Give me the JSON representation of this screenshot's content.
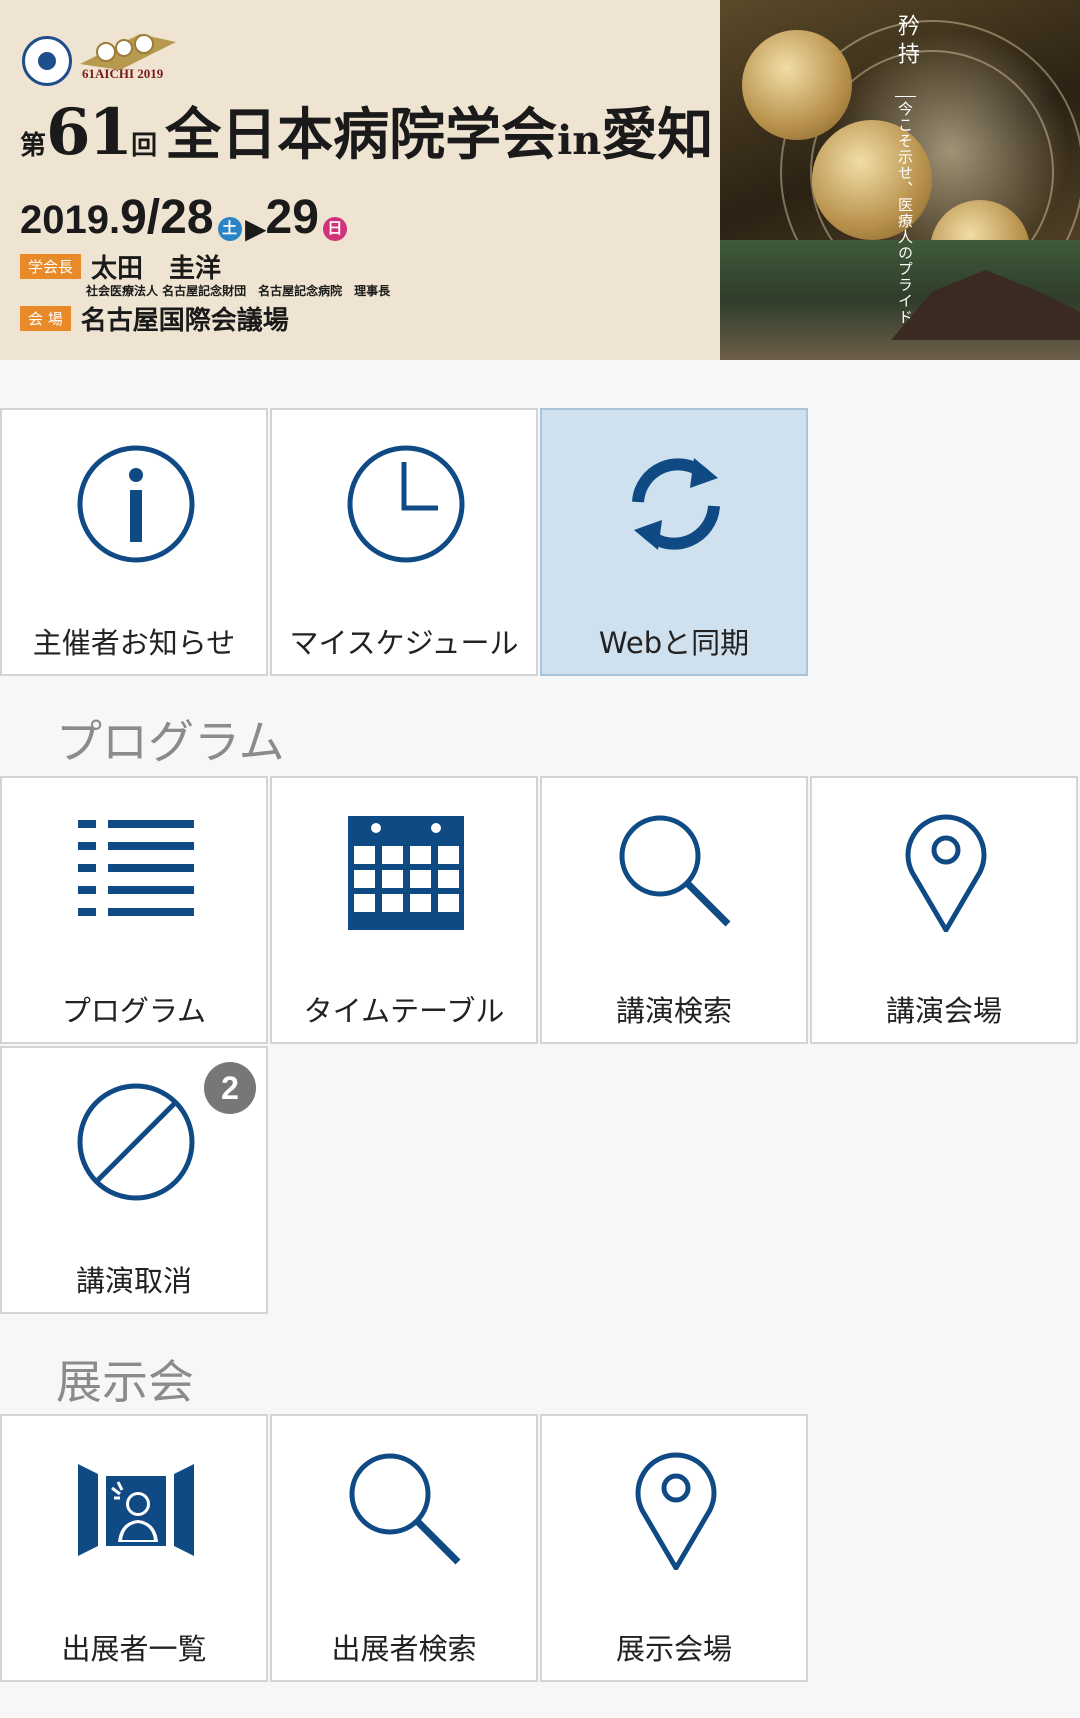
{
  "banner": {
    "logo_text": "61AICHI 2019",
    "title_ordinal": "第",
    "title_number": "61",
    "title_counter": "回",
    "title_main": "全日本病院学会",
    "title_in": "in",
    "title_place": "愛知",
    "date_year": "2019.",
    "date_month_day": "9/28",
    "date_start_dow": "土",
    "date_arrow": "▶",
    "date_end_day": "29",
    "date_end_dow": "日",
    "president_tag": "学会長",
    "president_name": "太田　圭洋",
    "president_affiliation": "社会医療法人 名古屋記念財団　名古屋記念病院　理事長",
    "venue_tag": "会 場",
    "venue_name": "名古屋国際会議場",
    "slogan": "矜持",
    "slogan_sub": "今こそ示せ、医療人のプライド"
  },
  "top_menu": [
    {
      "label": "主催者お知らせ",
      "icon": "info-icon"
    },
    {
      "label": "マイスケジュール",
      "icon": "clock-icon"
    },
    {
      "label": "Webと同期",
      "icon": "sync-icon",
      "active": true
    }
  ],
  "program_section": {
    "title": "プログラム",
    "items": [
      {
        "label": "プログラム",
        "icon": "list-icon"
      },
      {
        "label": "タイムテーブル",
        "icon": "calendar-icon"
      },
      {
        "label": "講演検索",
        "icon": "search-icon"
      },
      {
        "label": "講演会場",
        "icon": "map-pin-icon"
      },
      {
        "label": "講演取消",
        "icon": "cancel-icon",
        "badge": "2"
      }
    ]
  },
  "exhibition_section": {
    "title": "展示会",
    "items": [
      {
        "label": "出展者一覧",
        "icon": "exhibitor-icon"
      },
      {
        "label": "出展者検索",
        "icon": "search-icon"
      },
      {
        "label": "展示会場",
        "icon": "map-pin-icon"
      }
    ]
  },
  "colors": {
    "icon_blue": "#0f4a85",
    "active_tile": "#cfe0ee",
    "badge_gray": "#777777",
    "section_gray": "#8b8b8b"
  }
}
